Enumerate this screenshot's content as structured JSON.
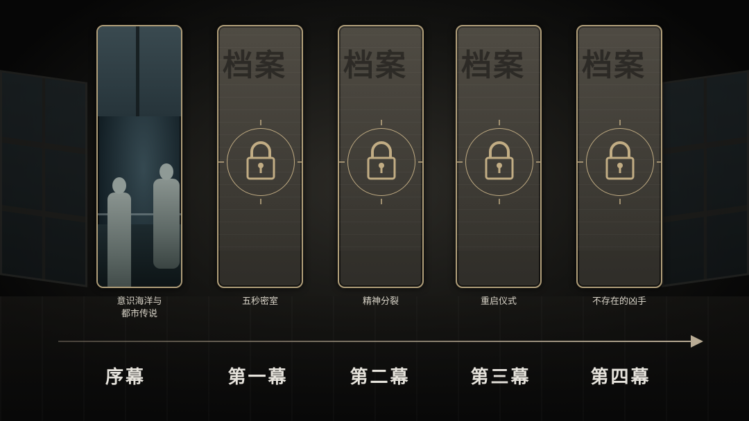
{
  "stamp_text": "档案",
  "chapters": [
    {
      "id": "prologue",
      "title_line1": "意识海洋与",
      "title_line2": "都市传说",
      "act": "序幕",
      "locked": false
    },
    {
      "id": "act1",
      "title_line1": "五秒密室",
      "title_line2": "",
      "act": "第一幕",
      "locked": true
    },
    {
      "id": "act2",
      "title_line1": "精神分裂",
      "title_line2": "",
      "act": "第二幕",
      "locked": true
    },
    {
      "id": "act3",
      "title_line1": "重启仪式",
      "title_line2": "",
      "act": "第三幕",
      "locked": true
    },
    {
      "id": "act4",
      "title_line1": "不存在的凶手",
      "title_line2": "",
      "act": "第四幕",
      "locked": true
    }
  ],
  "colors": {
    "frame_gold": "#b19f7a",
    "lock_gold": "#c2ad84",
    "text_light": "#e6e3dc",
    "background": "#0b0b0a"
  },
  "icons": {
    "lock": "padlock-icon",
    "timeline": "arrow-right-icon"
  }
}
